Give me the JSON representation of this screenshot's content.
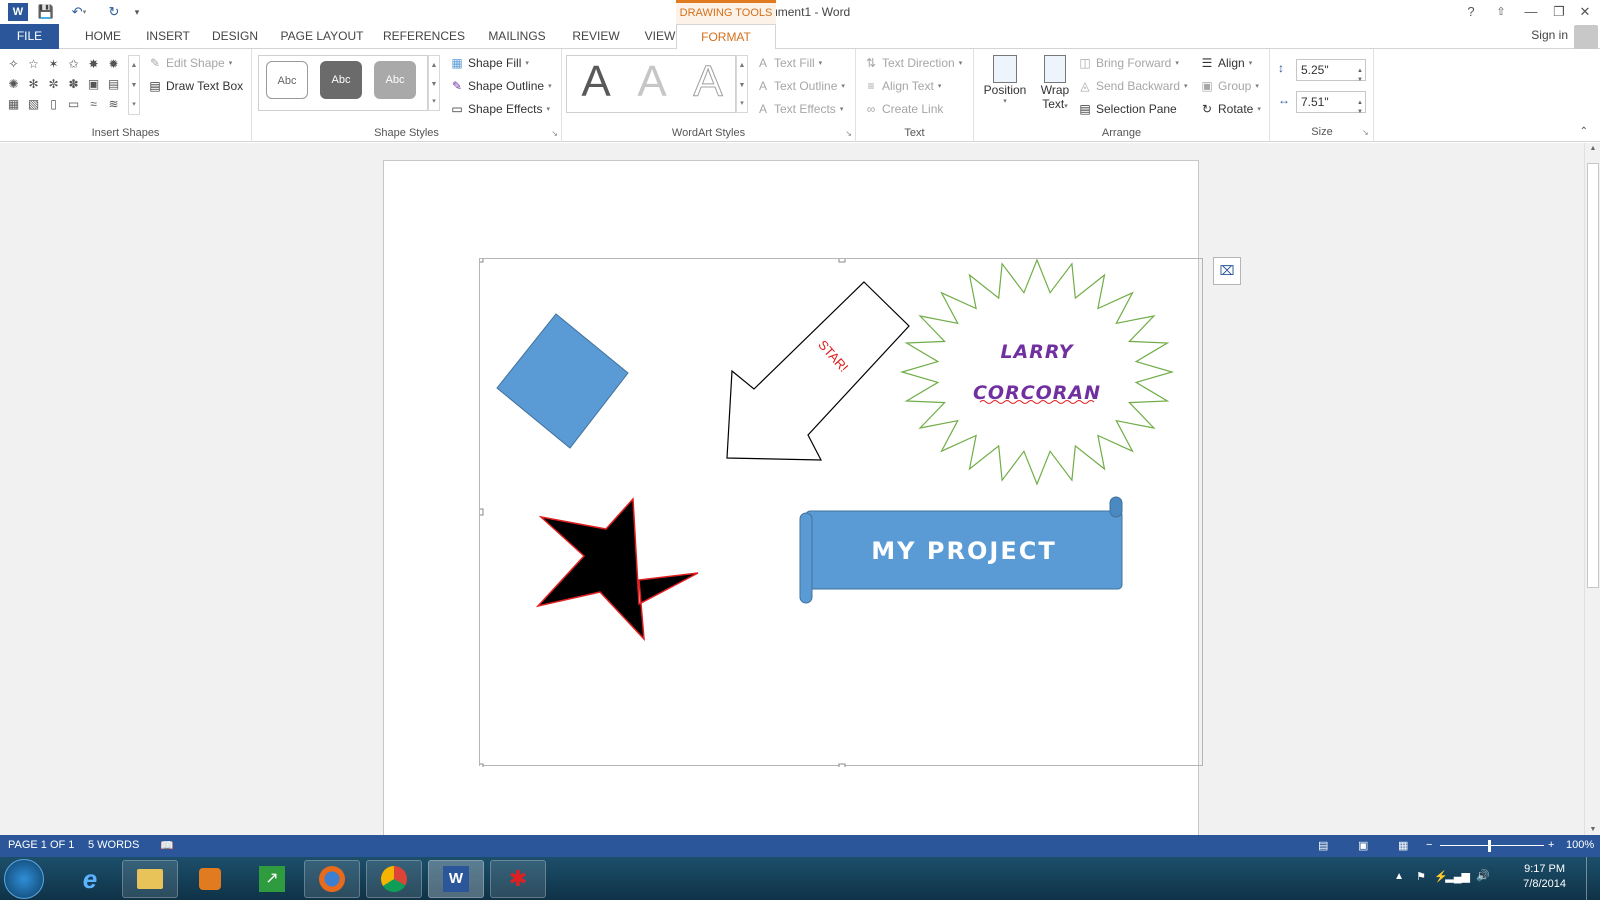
{
  "title_bar": {
    "doc_title": "Document1 - Word",
    "drawing_tools": "DRAWING TOOLS",
    "help": "?",
    "minimize": "—",
    "restore": "❐",
    "close": "✕"
  },
  "tabs": {
    "file": "FILE",
    "items": [
      "HOME",
      "INSERT",
      "DESIGN",
      "PAGE LAYOUT",
      "REFERENCES",
      "MAILINGS",
      "REVIEW",
      "VIEW"
    ],
    "format": "FORMAT",
    "sign_in": "Sign in"
  },
  "ribbon": {
    "insert_shapes": {
      "label": "Insert Shapes",
      "edit_shape": "Edit Shape",
      "draw_text_box": "Draw Text Box"
    },
    "shape_styles": {
      "label": "Shape Styles",
      "sample": "Abc",
      "shape_fill": "Shape Fill",
      "shape_outline": "Shape Outline",
      "shape_effects": "Shape Effects"
    },
    "wordart_styles": {
      "label": "WordArt Styles",
      "sample": "A",
      "text_fill": "Text Fill",
      "text_outline": "Text Outline",
      "text_effects": "Text Effects"
    },
    "text": {
      "label": "Text",
      "text_direction": "Text Direction",
      "align_text": "Align Text",
      "create_link": "Create Link"
    },
    "arrange": {
      "label": "Arrange",
      "position": "Position",
      "wrap_text_1": "Wrap",
      "wrap_text_2": "Text",
      "bring_forward": "Bring Forward",
      "send_backward": "Send Backward",
      "selection_pane": "Selection Pane",
      "align": "Align",
      "group": "Group",
      "rotate": "Rotate"
    },
    "size": {
      "label": "Size",
      "height": "5.25\"",
      "width": "7.51\""
    }
  },
  "document": {
    "arrow_text": "STAR!",
    "burst_line1": "LARRY",
    "burst_line2": "CORCORAN",
    "banner_text": "MY PROJECT"
  },
  "status_bar": {
    "page": "PAGE 1 OF 1",
    "words": "5 WORDS",
    "zoom": "100%"
  },
  "tray": {
    "time": "9:17 PM",
    "date": "7/8/2014"
  },
  "colors": {
    "accent": "#2b579a",
    "format_tab": "#d46f1a",
    "shape_blue": "#5b9bd5",
    "burst_outline": "#70ad47",
    "burst_text": "#7030a0",
    "arrow_text": "#e02020"
  }
}
